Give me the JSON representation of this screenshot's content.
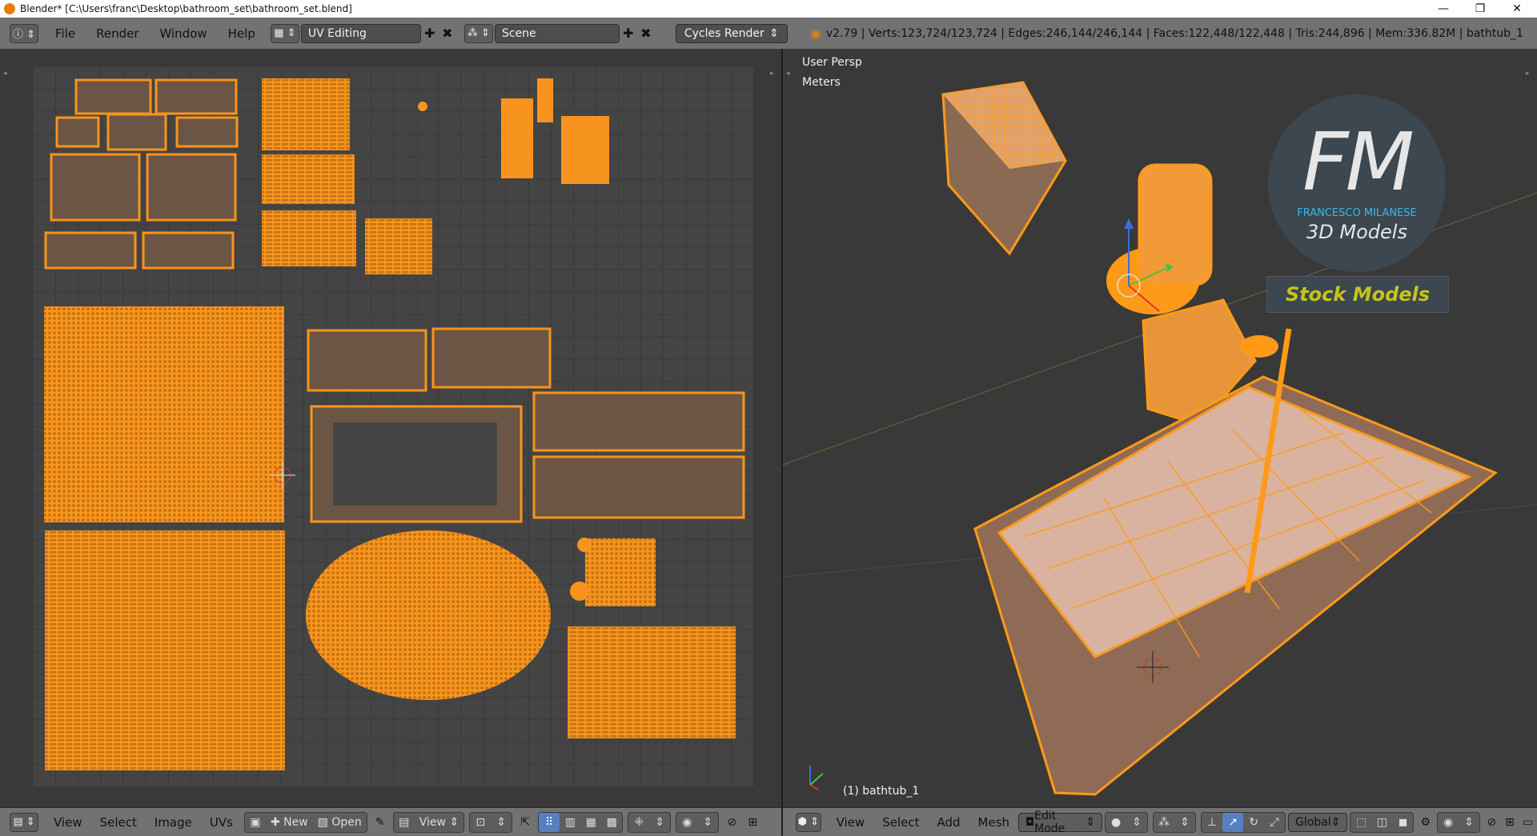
{
  "window": {
    "title": "Blender* [C:\\Users\\franc\\Desktop\\bathroom_set\\bathroom_set.blend]",
    "controls": [
      "—",
      "❐",
      "✕"
    ]
  },
  "topbar": {
    "menus": [
      "File",
      "Render",
      "Window",
      "Help"
    ],
    "layout": "UV Editing",
    "scene": "Scene",
    "engine": "Cycles Render",
    "stats": "v2.79 | Verts:123,724/123,724 | Edges:246,144/246,144 | Faces:122,448/122,448 | Tris:244,896 | Mem:336.82M | bathtub_1"
  },
  "viewport": {
    "persp": "User Persp",
    "units": "Meters",
    "object": "(1) bathtub_1",
    "logo_letters": "FM",
    "logo_name": "FRANCESCO MILANESE",
    "logo_sub": "3D Models",
    "stock": "Stock Models"
  },
  "uv_header": {
    "menus": [
      "View",
      "Select",
      "Image",
      "UVs"
    ],
    "new_label": "New",
    "open_label": "Open",
    "view_label": "View"
  },
  "vp_header": {
    "menus": [
      "View",
      "Select",
      "Add",
      "Mesh"
    ],
    "mode": "Edit Mode",
    "orientation": "Global"
  },
  "colors": {
    "uv_orange": "#f7941d",
    "mesh_orange": "#ff9a18",
    "face_fill": "#8a6a52",
    "header": "#727272",
    "bg": "#393939",
    "accent": "#5680c2"
  }
}
